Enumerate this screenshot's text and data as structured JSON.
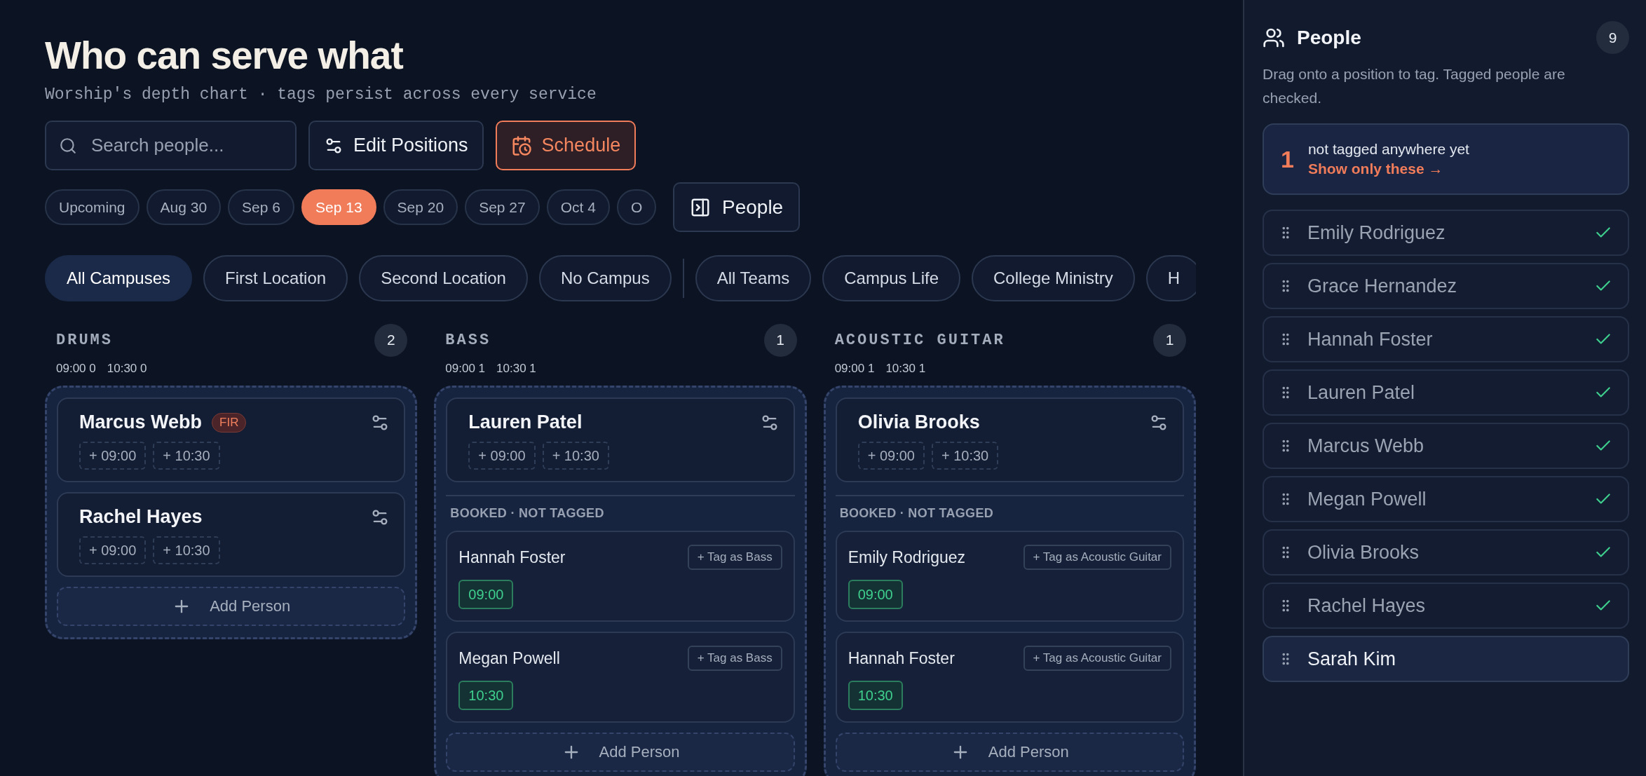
{
  "page": {
    "title": "Who can serve what",
    "subtitle": "Worship's depth chart · tags persist across every service"
  },
  "toolbar": {
    "search": {
      "placeholder": "Search people..."
    },
    "buttons": [
      {
        "label": "Edit Positions",
        "kind": "edit",
        "active": false
      },
      {
        "label": "Schedule",
        "kind": "schedule",
        "active": true
      }
    ]
  },
  "dates": [
    {
      "label": "Upcoming",
      "selected": false
    },
    {
      "label": "Aug 30",
      "selected": false
    },
    {
      "label": "Sep 6",
      "selected": false
    },
    {
      "label": "Sep 13",
      "selected": true
    },
    {
      "label": "Sep 20",
      "selected": false
    },
    {
      "label": "Sep 27",
      "selected": false
    },
    {
      "label": "Oct 4",
      "selected": false
    },
    {
      "label": "O",
      "selected": false
    }
  ],
  "people_toggle": {
    "label": "People"
  },
  "campus_filters": [
    {
      "label": "All Campuses",
      "selected": true
    },
    {
      "label": "First Location",
      "selected": false
    },
    {
      "label": "Second Location",
      "selected": false
    },
    {
      "label": "No Campus",
      "selected": false
    }
  ],
  "team_filters": [
    {
      "label": "All Teams",
      "selected": false
    },
    {
      "label": "Campus Life",
      "selected": false
    },
    {
      "label": "College Ministry",
      "selected": false
    },
    {
      "label": "H",
      "selected": false
    }
  ],
  "positions": [
    {
      "name": "DRUMS",
      "count": "2",
      "slot_counts": [
        {
          "time": "09:00",
          "count": "0"
        },
        {
          "time": "10:30",
          "count": "0"
        }
      ],
      "tagged": [
        {
          "name": "Marcus Webb",
          "badge": "FIR",
          "slots": [
            "+ 09:00",
            "+ 10:30"
          ]
        },
        {
          "name": "Rachel Hayes",
          "slots": [
            "+ 09:00",
            "+ 10:30"
          ]
        }
      ],
      "add_label": "Add Person"
    },
    {
      "name": "BASS",
      "count": "1",
      "slot_counts": [
        {
          "time": "09:00",
          "count": "1"
        },
        {
          "time": "10:30",
          "count": "1"
        }
      ],
      "tagged": [
        {
          "name": "Lauren Patel",
          "slots": [
            "+ 09:00",
            "+ 10:30"
          ]
        }
      ],
      "booked": {
        "label": "BOOKED · NOT TAGGED",
        "people": [
          {
            "name": "Hannah Foster",
            "action": "+ Tag as Bass",
            "time": "09:00"
          },
          {
            "name": "Megan Powell",
            "action": "+ Tag as Bass",
            "time": "10:30"
          }
        ]
      },
      "add_label": "Add Person"
    },
    {
      "name": "ACOUSTIC GUITAR",
      "count": "1",
      "slot_counts": [
        {
          "time": "09:00",
          "count": "1"
        },
        {
          "time": "10:30",
          "count": "1"
        }
      ],
      "tagged": [
        {
          "name": "Olivia Brooks",
          "slots": [
            "+ 09:00",
            "+ 10:30"
          ]
        }
      ],
      "booked": {
        "label": "BOOKED · NOT TAGGED",
        "people": [
          {
            "name": "Emily Rodriguez",
            "action": "+ Tag as Acoustic Guitar",
            "time": "09:00"
          },
          {
            "name": "Hannah Foster",
            "action": "+ Tag as Acoustic Guitar",
            "time": "10:30"
          }
        ]
      },
      "add_label": "Add Person"
    }
  ],
  "panel": {
    "title": "People",
    "count": "9",
    "hint": "Drag onto a position to tag. Tagged people are checked.",
    "untagged": {
      "count": "1",
      "text": "not tagged anywhere yet",
      "link": "Show only these →"
    },
    "people": [
      {
        "name": "Emily Rodriguez",
        "checked": true
      },
      {
        "name": "Grace Hernandez",
        "checked": true
      },
      {
        "name": "Hannah Foster",
        "checked": true
      },
      {
        "name": "Lauren Patel",
        "checked": true
      },
      {
        "name": "Marcus Webb",
        "checked": true
      },
      {
        "name": "Megan Powell",
        "checked": true
      },
      {
        "name": "Olivia Brooks",
        "checked": true
      },
      {
        "name": "Rachel Hayes",
        "checked": true
      },
      {
        "name": "Sarah Kim",
        "checked": false
      }
    ]
  }
}
